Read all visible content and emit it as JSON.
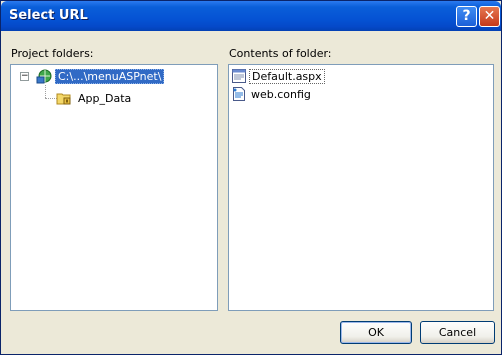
{
  "window": {
    "title": "Select URL"
  },
  "titlebar_buttons": {
    "help": "?",
    "close": "✕"
  },
  "left": {
    "label": "Project folders:",
    "root": {
      "label": "C:\\...\\menuASPnet\\",
      "icon": "web-project-icon",
      "expander": "⊟"
    },
    "children": [
      {
        "label": "App_Data",
        "icon": "locked-folder-icon"
      }
    ]
  },
  "right": {
    "label": "Contents of folder:",
    "items": [
      {
        "label": "Default.aspx",
        "icon": "aspx-page-icon"
      },
      {
        "label": "web.config",
        "icon": "config-file-icon"
      }
    ]
  },
  "buttons": {
    "ok": "OK",
    "cancel": "Cancel"
  }
}
